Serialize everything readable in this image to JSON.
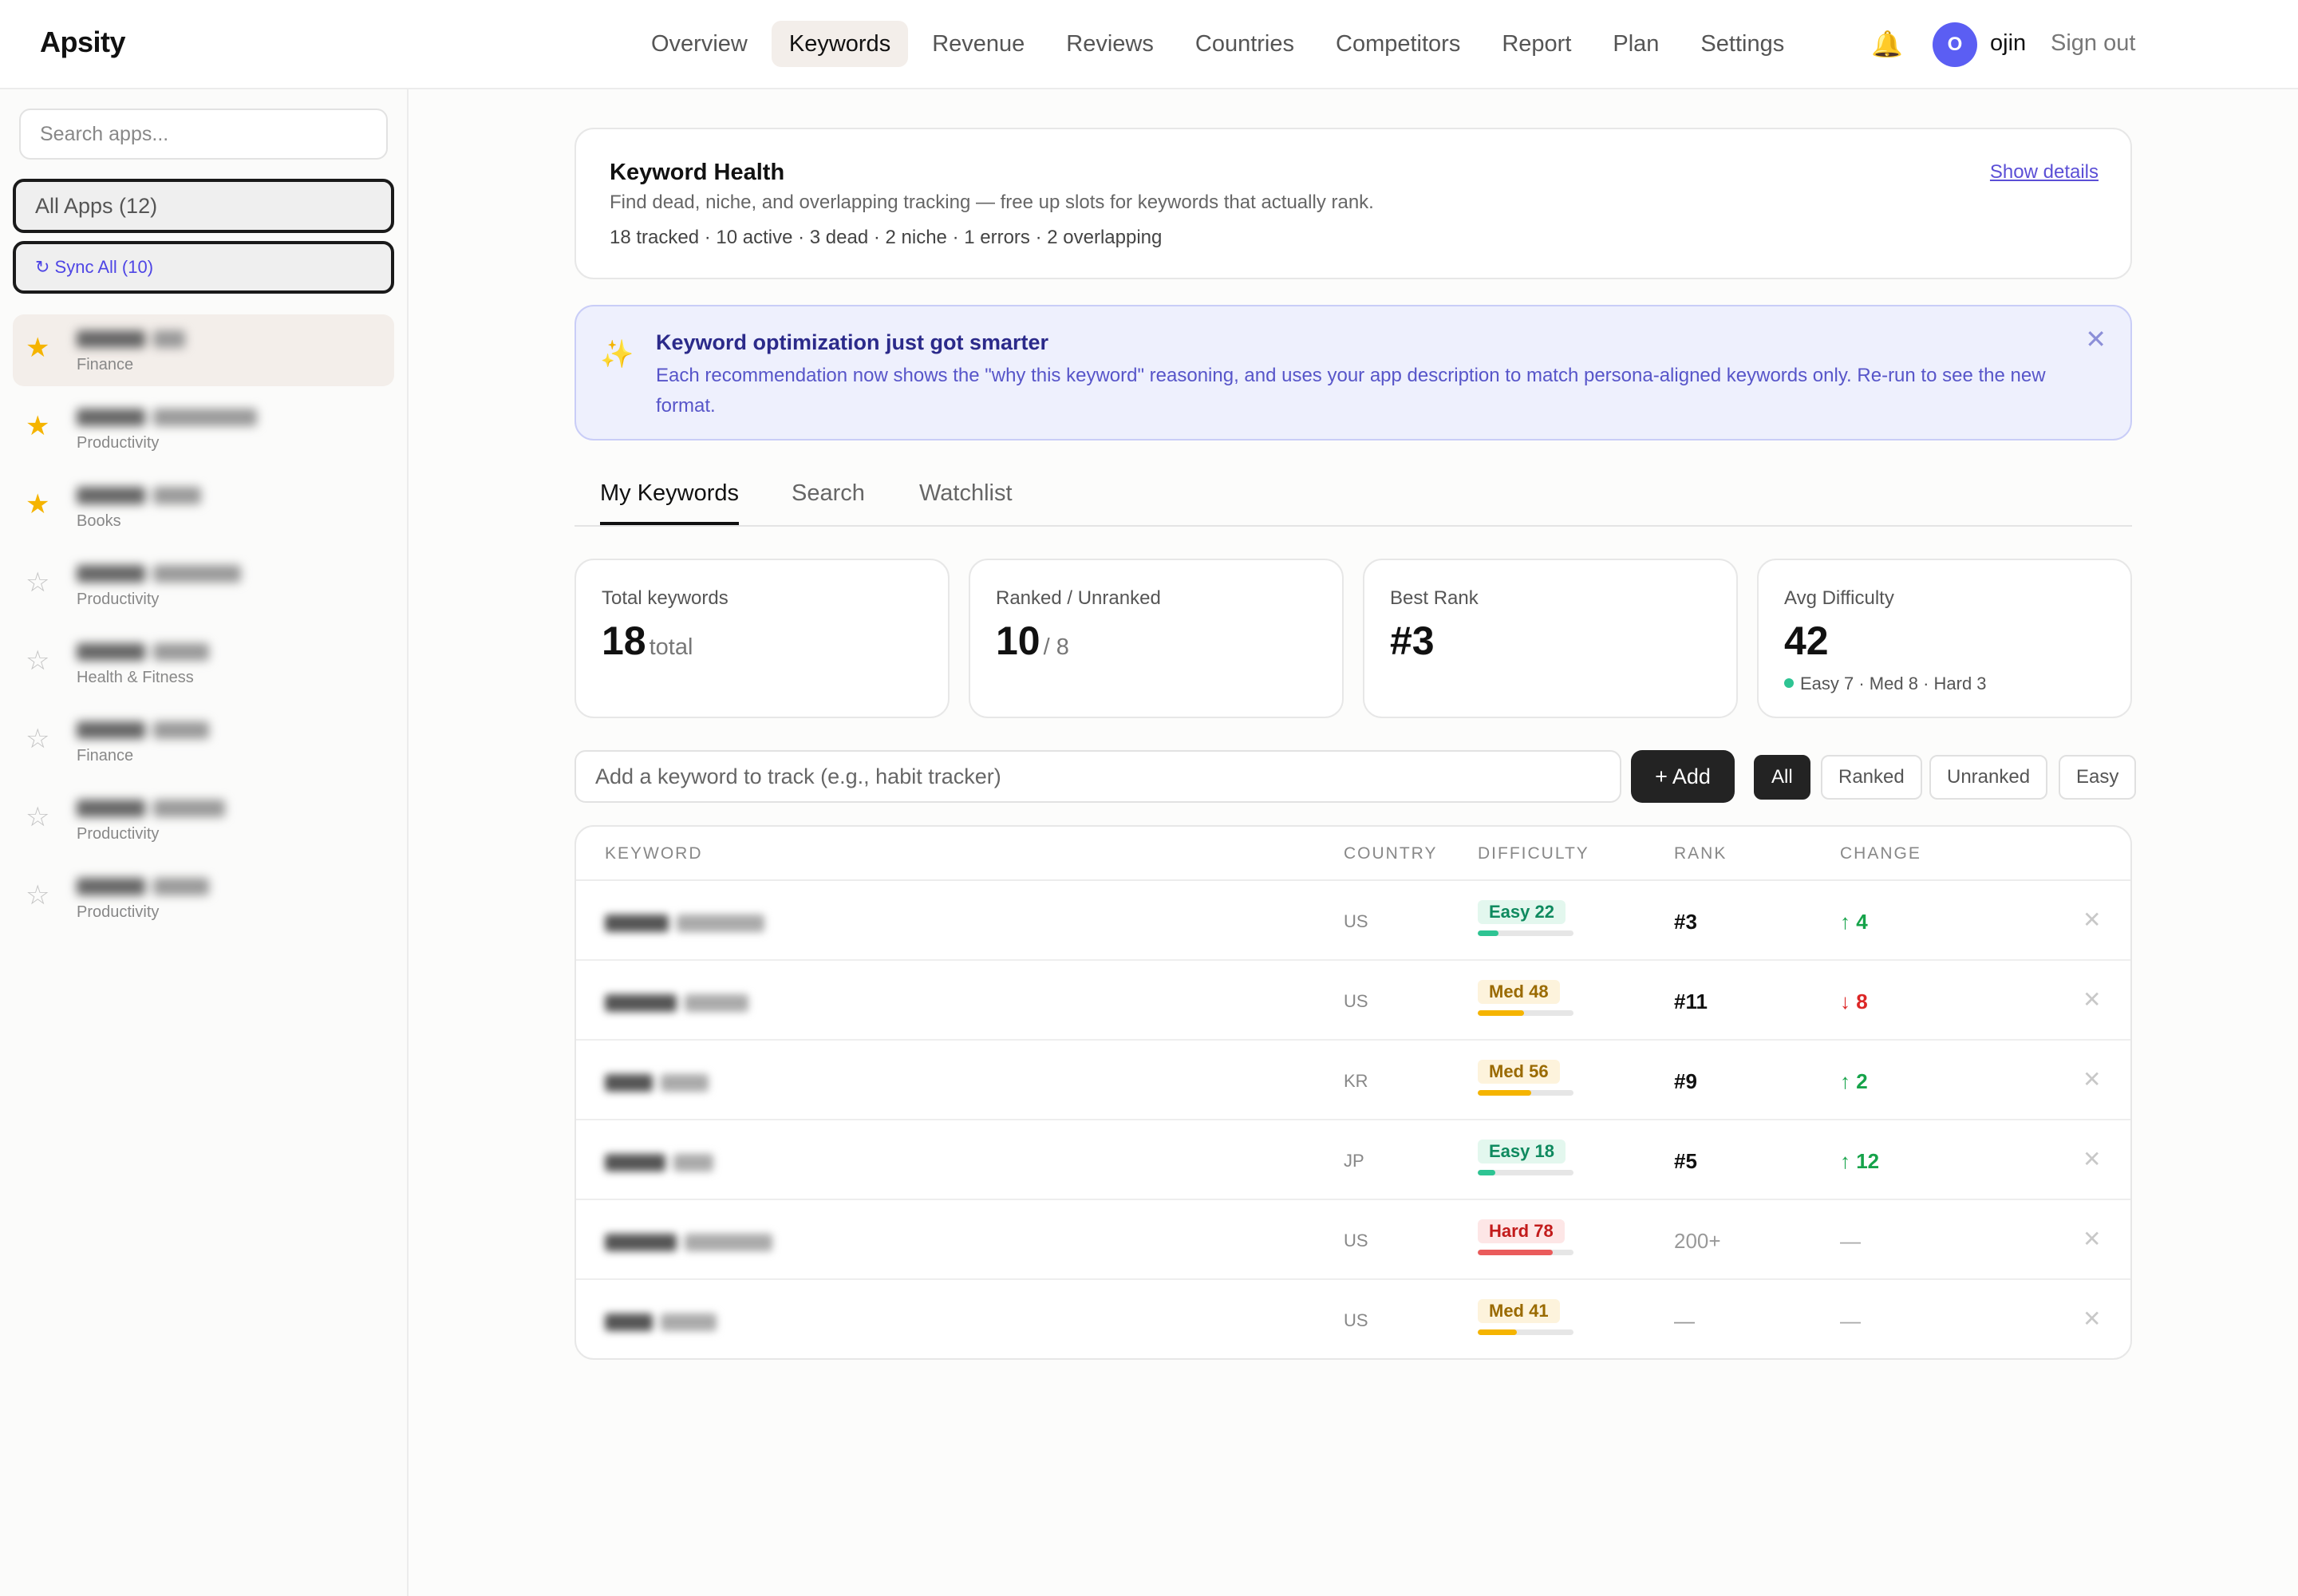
{
  "header": {
    "logo": "Apsity",
    "nav": [
      "Overview",
      "Keywords",
      "Revenue",
      "Reviews",
      "Countries",
      "Competitors",
      "Report",
      "Plan",
      "Settings"
    ],
    "active_nav": "Keywords",
    "bell": "🔔",
    "avatar_initial": "O",
    "username": "ojin",
    "signout": "Sign out"
  },
  "sidebar": {
    "search_placeholder": "Search apps...",
    "all_apps": "All Apps (12)",
    "sync_all": "↻ Sync All (10)",
    "apps": [
      {
        "starred": true,
        "category": "Finance"
      },
      {
        "starred": true,
        "category": "Productivity"
      },
      {
        "starred": true,
        "category": "Books"
      },
      {
        "starred": false,
        "category": "Productivity"
      },
      {
        "starred": false,
        "category": "Health & Fitness"
      },
      {
        "starred": false,
        "category": "Finance"
      },
      {
        "starred": false,
        "category": "Productivity"
      },
      {
        "starred": false,
        "category": "Productivity"
      }
    ]
  },
  "health": {
    "title": "Keyword Health",
    "desc": "Find dead, niche, and overlapping tracking — free up slots for keywords that actually rank.",
    "stats": "18 tracked · 10 active · 3 dead · 2 niche · 1 errors · 2 overlapping",
    "show_details": "Show details"
  },
  "banner": {
    "icon": "✨",
    "title": "Keyword optimization just got smarter",
    "text": "Each recommendation now shows the \"why this keyword\" reasoning, and uses your app description to match persona-aligned keywords only. Re-run to see the new format.",
    "close": "✕"
  },
  "tabs": [
    "My Keywords",
    "Search",
    "Watchlist"
  ],
  "stats": {
    "total": {
      "label": "Total keywords",
      "value": "18",
      "suffix": "total"
    },
    "ranked": {
      "label": "Ranked / Unranked",
      "value": "10",
      "suffix": "/ 8"
    },
    "best": {
      "label": "Best Rank",
      "value": "#3"
    },
    "difficulty": {
      "label": "Avg Difficulty",
      "value": "42",
      "sub": "Easy 7 · Med 8 · Hard 3"
    }
  },
  "add": {
    "placeholder": "Add a keyword to track (e.g., habit tracker)",
    "button": "+ Add"
  },
  "filters": [
    "All",
    "Ranked",
    "Unranked",
    "Easy"
  ],
  "table": {
    "headers": {
      "keyword": "KEYWORD",
      "country": "COUNTRY",
      "difficulty": "DIFFICULTY",
      "rank": "RANK",
      "change": "CHANGE"
    },
    "rows": [
      {
        "country": "US",
        "diff_label": "Easy 22",
        "diff_level": "easy",
        "diff": 22,
        "rank": "#3",
        "change": "↑ 4",
        "dir": "up"
      },
      {
        "country": "US",
        "diff_label": "Med 48",
        "diff_level": "med",
        "diff": 48,
        "rank": "#11",
        "change": "↓ 8",
        "dir": "down"
      },
      {
        "country": "KR",
        "diff_label": "Med 56",
        "diff_level": "med",
        "diff": 56,
        "rank": "#9",
        "change": "↑ 2",
        "dir": "up"
      },
      {
        "country": "JP",
        "diff_label": "Easy 18",
        "diff_level": "easy",
        "diff": 18,
        "rank": "#5",
        "change": "↑ 12",
        "dir": "up"
      },
      {
        "country": "US",
        "diff_label": "Hard 78",
        "diff_level": "hard",
        "diff": 78,
        "rank": "200+",
        "change": "—",
        "dir": "none"
      },
      {
        "country": "US",
        "diff_label": "Med 41",
        "diff_level": "med",
        "diff": 41,
        "rank": "—",
        "change": "—",
        "dir": "none"
      }
    ]
  },
  "colors": {
    "easy_bg": "#e3f7ee",
    "easy_fg": "#0f8a5f",
    "easy_bar": "#2ec493",
    "med_bg": "#fdf3dc",
    "med_fg": "#9a6a00",
    "med_bar": "#f5b400",
    "hard_bg": "#fde6e6",
    "hard_fg": "#c21b1b",
    "hard_bar": "#ea5b5b",
    "accent": "#5b5ef3"
  }
}
